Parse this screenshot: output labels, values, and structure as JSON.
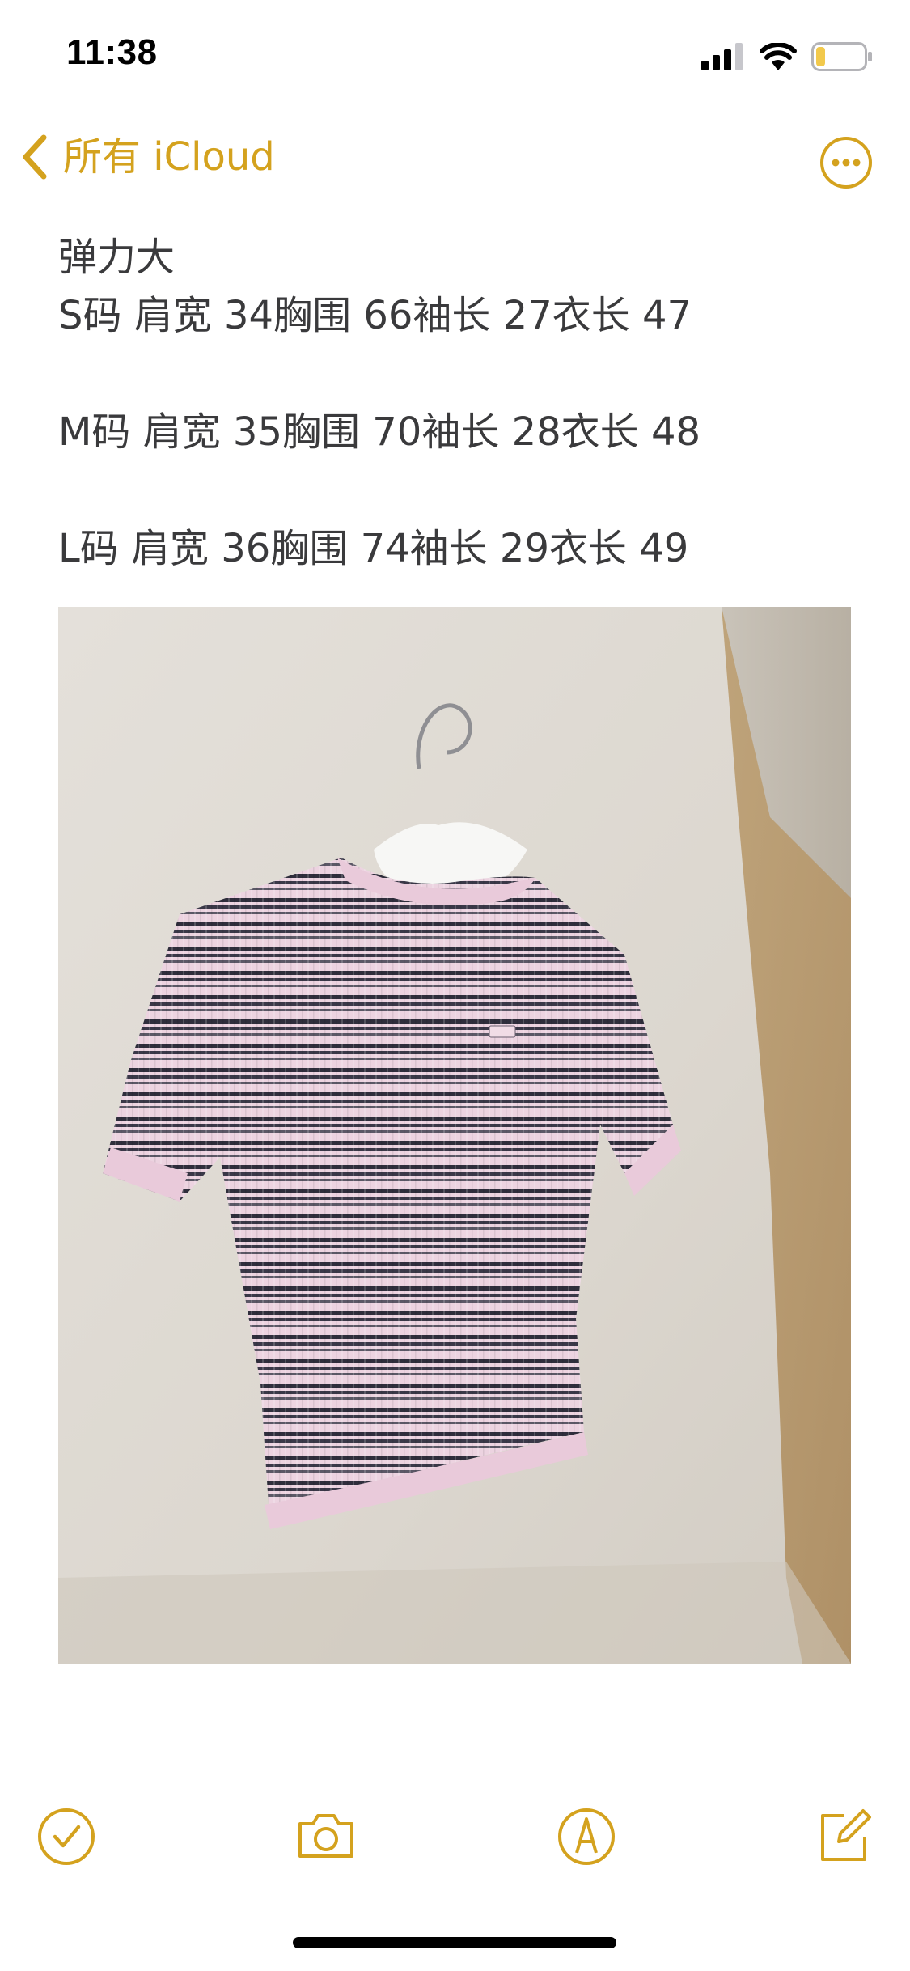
{
  "status_bar": {
    "time": "11:38",
    "icons": [
      "cellular-signal-icon",
      "wifi-icon",
      "battery-icon"
    ],
    "battery_level": 0.2
  },
  "nav": {
    "back_icon": "chevron-left-icon",
    "back_label": "所有 iCloud",
    "more_icon": "ellipsis-circle-icon"
  },
  "note": {
    "lines": [
      "弹力大",
      "S码 肩宽 34胸围 66袖长 27衣长 47",
      "",
      "M码 肩宽 35胸围 70袖长 28衣长 48",
      "",
      "L码 肩宽 36胸围 74袖长 29衣长 49"
    ],
    "image": {
      "kind": "photo",
      "subject": "striped-short-sleeve-knit-top-on-hanger"
    }
  },
  "toolbar": {
    "icons": [
      "checklist-icon",
      "camera-icon",
      "markup-pen-icon",
      "compose-icon"
    ]
  },
  "colors": {
    "accent": "#d4a21e",
    "text": "#3a3a3c",
    "background": "#ffffff"
  }
}
